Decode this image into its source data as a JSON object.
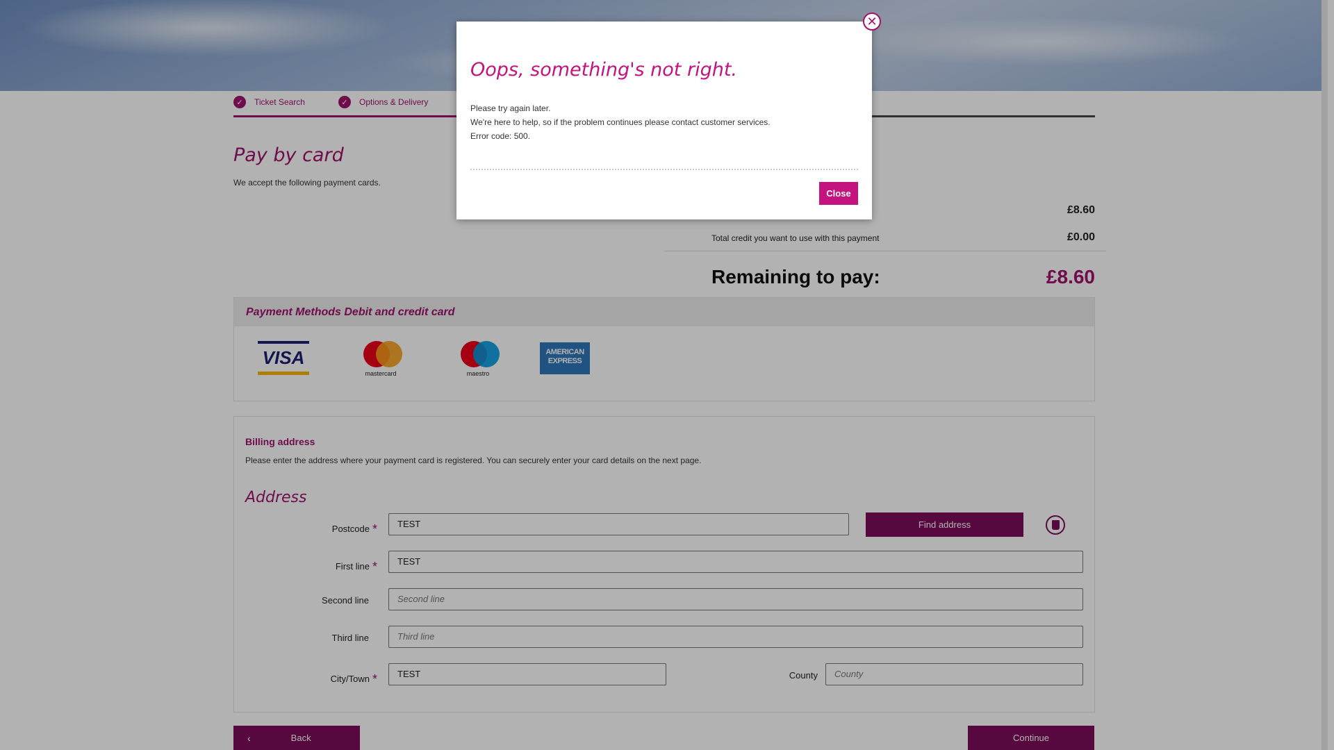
{
  "progress": {
    "steps": [
      {
        "label": "Ticket Search"
      },
      {
        "label": "Options & Delivery"
      }
    ]
  },
  "payment": {
    "title": "Pay by card",
    "subtitle": "We accept the following payment cards."
  },
  "summary": {
    "total_amount": "£8.60",
    "credit_label": "Total credit you want to use with this payment",
    "credit_amount": "£0.00",
    "remaining_label": "Remaining to pay:",
    "remaining_amount": "£8.60"
  },
  "methods": {
    "heading": "Payment Methods Debit and credit card",
    "cards": {
      "visa": "VISA",
      "mastercard": "mastercard",
      "maestro": "maestro",
      "amex": "AMERICAN EXPRESS"
    }
  },
  "billing": {
    "title": "Billing address",
    "description": "Please enter the address where your payment card is registered. You can securely enter your card details on the next page.",
    "address_title": "Address",
    "postcode": {
      "label": "Postcode",
      "value": "TEST"
    },
    "first_line": {
      "label": "First line",
      "value": "TEST"
    },
    "second_line": {
      "label": "Second line",
      "placeholder": "Second line"
    },
    "third_line": {
      "label": "Third line",
      "placeholder": "Third line"
    },
    "city": {
      "label": "City/Town",
      "value": "TEST"
    },
    "county": {
      "label": "County",
      "placeholder": "County"
    },
    "find_address_label": "Find address",
    "delete_icon": "trash-icon"
  },
  "nav": {
    "back_label": "Back",
    "continue_label": "Continue"
  },
  "modal": {
    "title": "Oops, something's not right.",
    "line1": "Please try again later.",
    "line2": "We're here to help, so if the problem continues please contact customer services.",
    "line3": "Error code: 500.",
    "close_label": "Close",
    "close_icon": "close-icon"
  },
  "colors": {
    "brand": "#a0126e",
    "brand_dark": "#7d0c5a",
    "modal_accent": "#c4127e"
  }
}
